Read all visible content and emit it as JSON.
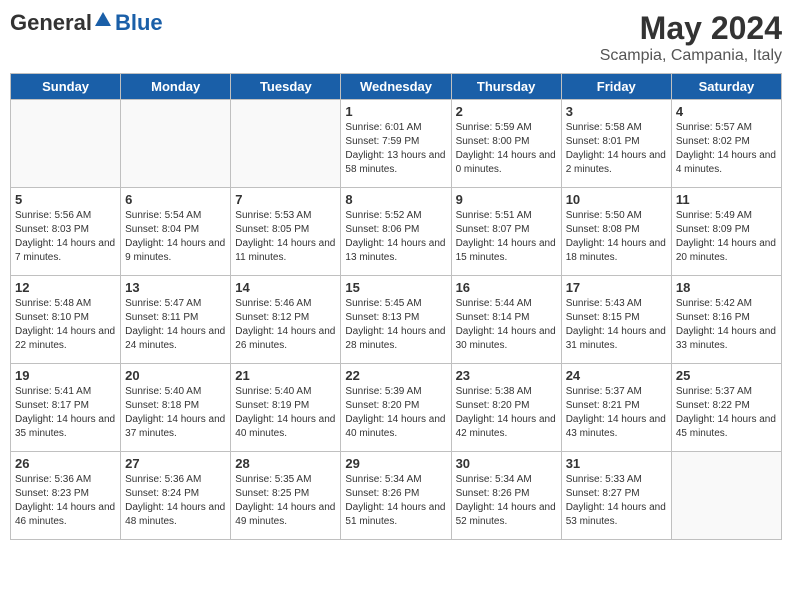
{
  "header": {
    "logo": {
      "general": "General",
      "blue": "Blue"
    },
    "title": "May 2024",
    "location": "Scampia, Campania, Italy"
  },
  "weekdays": [
    "Sunday",
    "Monday",
    "Tuesday",
    "Wednesday",
    "Thursday",
    "Friday",
    "Saturday"
  ],
  "weeks": [
    [
      {
        "day": "",
        "info": ""
      },
      {
        "day": "",
        "info": ""
      },
      {
        "day": "",
        "info": ""
      },
      {
        "day": "1",
        "info": "Sunrise: 6:01 AM\nSunset: 7:59 PM\nDaylight: 13 hours\nand 58 minutes."
      },
      {
        "day": "2",
        "info": "Sunrise: 5:59 AM\nSunset: 8:00 PM\nDaylight: 14 hours\nand 0 minutes."
      },
      {
        "day": "3",
        "info": "Sunrise: 5:58 AM\nSunset: 8:01 PM\nDaylight: 14 hours\nand 2 minutes."
      },
      {
        "day": "4",
        "info": "Sunrise: 5:57 AM\nSunset: 8:02 PM\nDaylight: 14 hours\nand 4 minutes."
      }
    ],
    [
      {
        "day": "5",
        "info": "Sunrise: 5:56 AM\nSunset: 8:03 PM\nDaylight: 14 hours\nand 7 minutes."
      },
      {
        "day": "6",
        "info": "Sunrise: 5:54 AM\nSunset: 8:04 PM\nDaylight: 14 hours\nand 9 minutes."
      },
      {
        "day": "7",
        "info": "Sunrise: 5:53 AM\nSunset: 8:05 PM\nDaylight: 14 hours\nand 11 minutes."
      },
      {
        "day": "8",
        "info": "Sunrise: 5:52 AM\nSunset: 8:06 PM\nDaylight: 14 hours\nand 13 minutes."
      },
      {
        "day": "9",
        "info": "Sunrise: 5:51 AM\nSunset: 8:07 PM\nDaylight: 14 hours\nand 15 minutes."
      },
      {
        "day": "10",
        "info": "Sunrise: 5:50 AM\nSunset: 8:08 PM\nDaylight: 14 hours\nand 18 minutes."
      },
      {
        "day": "11",
        "info": "Sunrise: 5:49 AM\nSunset: 8:09 PM\nDaylight: 14 hours\nand 20 minutes."
      }
    ],
    [
      {
        "day": "12",
        "info": "Sunrise: 5:48 AM\nSunset: 8:10 PM\nDaylight: 14 hours\nand 22 minutes."
      },
      {
        "day": "13",
        "info": "Sunrise: 5:47 AM\nSunset: 8:11 PM\nDaylight: 14 hours\nand 24 minutes."
      },
      {
        "day": "14",
        "info": "Sunrise: 5:46 AM\nSunset: 8:12 PM\nDaylight: 14 hours\nand 26 minutes."
      },
      {
        "day": "15",
        "info": "Sunrise: 5:45 AM\nSunset: 8:13 PM\nDaylight: 14 hours\nand 28 minutes."
      },
      {
        "day": "16",
        "info": "Sunrise: 5:44 AM\nSunset: 8:14 PM\nDaylight: 14 hours\nand 30 minutes."
      },
      {
        "day": "17",
        "info": "Sunrise: 5:43 AM\nSunset: 8:15 PM\nDaylight: 14 hours\nand 31 minutes."
      },
      {
        "day": "18",
        "info": "Sunrise: 5:42 AM\nSunset: 8:16 PM\nDaylight: 14 hours\nand 33 minutes."
      }
    ],
    [
      {
        "day": "19",
        "info": "Sunrise: 5:41 AM\nSunset: 8:17 PM\nDaylight: 14 hours\nand 35 minutes."
      },
      {
        "day": "20",
        "info": "Sunrise: 5:40 AM\nSunset: 8:18 PM\nDaylight: 14 hours\nand 37 minutes."
      },
      {
        "day": "21",
        "info": "Sunrise: 5:40 AM\nSunset: 8:19 PM\nDaylight: 14 hours\nand 40 minutes."
      },
      {
        "day": "22",
        "info": "Sunrise: 5:39 AM\nSunset: 8:20 PM\nDaylight: 14 hours\nand 40 minutes."
      },
      {
        "day": "23",
        "info": "Sunrise: 5:38 AM\nSunset: 8:20 PM\nDaylight: 14 hours\nand 42 minutes."
      },
      {
        "day": "24",
        "info": "Sunrise: 5:37 AM\nSunset: 8:21 PM\nDaylight: 14 hours\nand 43 minutes."
      },
      {
        "day": "25",
        "info": "Sunrise: 5:37 AM\nSunset: 8:22 PM\nDaylight: 14 hours\nand 45 minutes."
      }
    ],
    [
      {
        "day": "26",
        "info": "Sunrise: 5:36 AM\nSunset: 8:23 PM\nDaylight: 14 hours\nand 46 minutes."
      },
      {
        "day": "27",
        "info": "Sunrise: 5:36 AM\nSunset: 8:24 PM\nDaylight: 14 hours\nand 48 minutes."
      },
      {
        "day": "28",
        "info": "Sunrise: 5:35 AM\nSunset: 8:25 PM\nDaylight: 14 hours\nand 49 minutes."
      },
      {
        "day": "29",
        "info": "Sunrise: 5:34 AM\nSunset: 8:26 PM\nDaylight: 14 hours\nand 51 minutes."
      },
      {
        "day": "30",
        "info": "Sunrise: 5:34 AM\nSunset: 8:26 PM\nDaylight: 14 hours\nand 52 minutes."
      },
      {
        "day": "31",
        "info": "Sunrise: 5:33 AM\nSunset: 8:27 PM\nDaylight: 14 hours\nand 53 minutes."
      },
      {
        "day": "",
        "info": ""
      }
    ]
  ]
}
